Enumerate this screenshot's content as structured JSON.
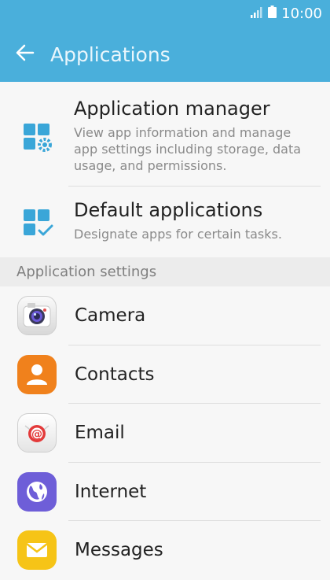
{
  "status_bar": {
    "time": "10:00",
    "icons": [
      "signal-icon",
      "battery-icon"
    ]
  },
  "header": {
    "title": "Applications",
    "back_icon": "arrow-left-icon"
  },
  "top_items": [
    {
      "title": "Application manager",
      "description": "View app information and manage app settings including storage, data usage, and permissions.",
      "icon": "app-manager-icon"
    },
    {
      "title": "Default applications",
      "description": "Designate apps for certain tasks.",
      "icon": "default-apps-icon"
    }
  ],
  "section_header": "Application settings",
  "apps": [
    {
      "label": "Camera",
      "icon": "camera-icon"
    },
    {
      "label": "Contacts",
      "icon": "contacts-icon"
    },
    {
      "label": "Email",
      "icon": "email-icon"
    },
    {
      "label": "Internet",
      "icon": "internet-icon"
    },
    {
      "label": "Messages",
      "icon": "messages-icon"
    }
  ],
  "colors": {
    "accent": "#4aafdb",
    "icon_blue": "#3aa6d8"
  }
}
